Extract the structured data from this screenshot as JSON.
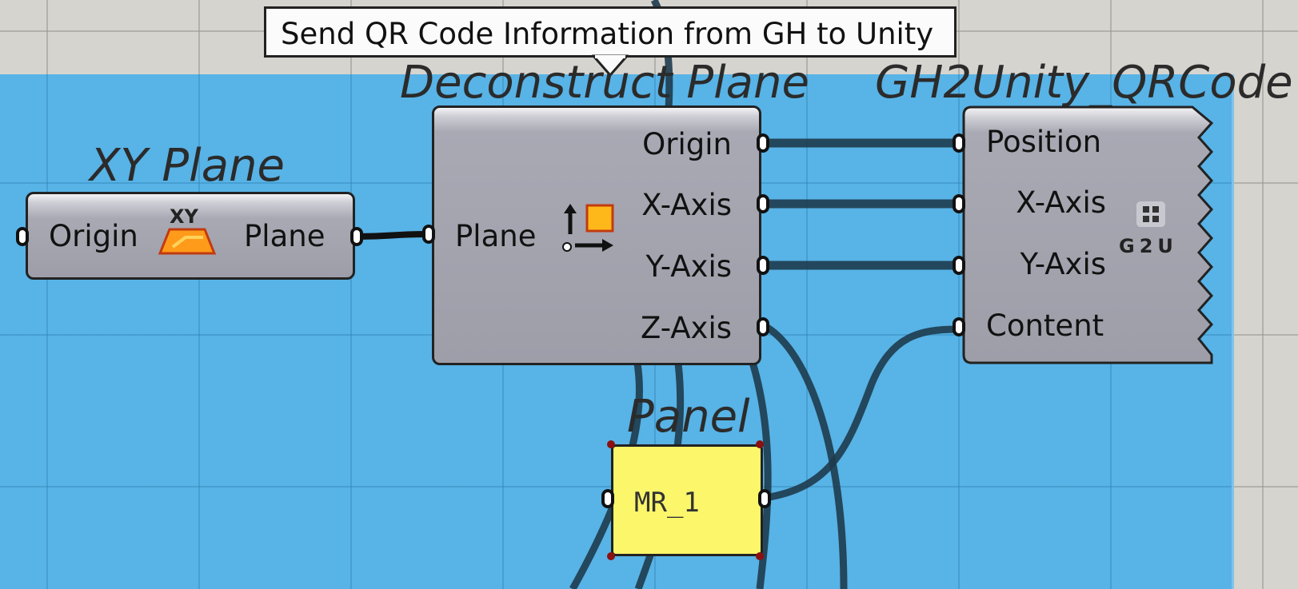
{
  "tooltip": {
    "text": "Send QR Code Information from GH to Unity"
  },
  "xy_plane": {
    "title": "XY Plane",
    "input_label": "Origin",
    "output_label": "Plane",
    "icon_text": "XY",
    "icon": "xy-plane-icon"
  },
  "deconstruct_plane": {
    "title": "Deconstruct Plane",
    "input_label": "Plane",
    "outputs": [
      "Origin",
      "X-Axis",
      "Y-Axis",
      "Z-Axis"
    ],
    "icon": "deconstruct-plane-icon"
  },
  "gh2unity": {
    "title": "GH2Unity_QRCode",
    "inputs": [
      "Position",
      "X-Axis",
      "Y-Axis",
      "Content"
    ],
    "icon_text": "G2U",
    "icon": "qr-code-icon"
  },
  "panel": {
    "title": "Panel",
    "content": "MR_1"
  },
  "colors": {
    "group_fill": "#58b3e6",
    "canvas_bg": "#d6d4cf",
    "component_body": "#a9a9b4",
    "panel_fill": "#fbf66a",
    "wire": "#1e3b4c",
    "icon_orange": "#ff9b1a"
  }
}
